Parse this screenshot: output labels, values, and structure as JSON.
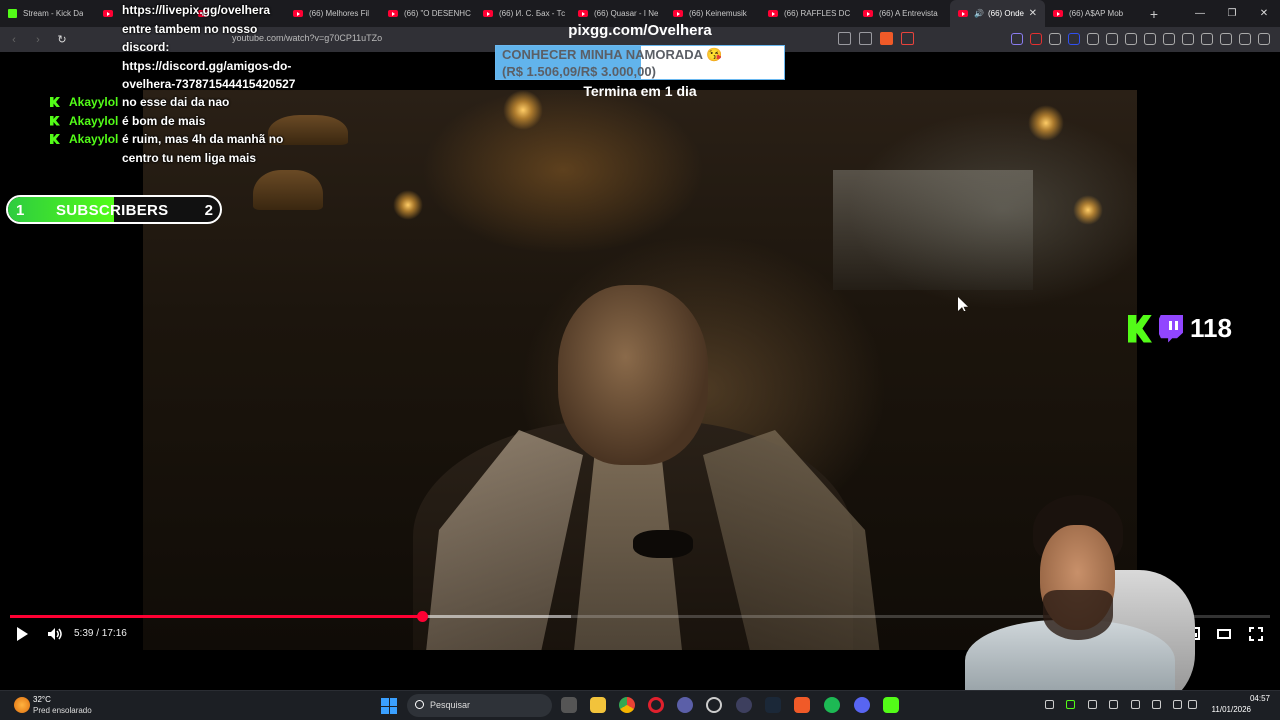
{
  "browser": {
    "tabs": [
      {
        "label": "Stream - Kick Da",
        "kind": "kick"
      },
      {
        "label": "",
        "kind": "youtube"
      },
      {
        "label": "",
        "kind": "youtube"
      },
      {
        "label": "(66) Melhores Fil",
        "kind": "youtube"
      },
      {
        "label": "(66) \"O DESENHC",
        "kind": "youtube"
      },
      {
        "label": "(66) И. С. Бах - Тс",
        "kind": "youtube"
      },
      {
        "label": "(66) Quasar - I Ne",
        "kind": "youtube"
      },
      {
        "label": "(66) Keinemusik",
        "kind": "youtube"
      },
      {
        "label": "(66) RAFFLES DC",
        "kind": "youtube"
      },
      {
        "label": "(66) A Entrevista",
        "kind": "youtube"
      },
      {
        "label": "(66) Onde",
        "kind": "youtube",
        "active": true,
        "close": "✕"
      },
      {
        "label": "(66) A$AP Mob",
        "kind": "youtube"
      }
    ],
    "new_tab": "+",
    "url": "youtube.com/watch?v=g70CP11uTZo"
  },
  "chat": {
    "first_message": "https://livepix.gg/ovelhera entre tambem no nosso discord: https://discord.gg/amigos-do-ovelhera-737871544415420527",
    "messages": [
      {
        "user": "Akayylol",
        "text": "no esse dai da nao"
      },
      {
        "user": "Akayylol",
        "text": "é bom de mais"
      },
      {
        "user": "Akayylol",
        "text": "é ruim, mas 4h da manhã no centro tu nem liga mais"
      }
    ]
  },
  "sub_goal": {
    "start": "1",
    "label": "SUBSCRIBERS",
    "end": "2",
    "progress": 0.5
  },
  "pix_goal": {
    "title": "pixgg.com/Ovelhera",
    "goal_name": "CONHECER MINHA NAMORADA 😘",
    "amount": "(R$ 1.506,09/R$ 3.000,00)",
    "progress": 0.502,
    "ends": "Termina em 1 dia"
  },
  "viewers": {
    "count": "118"
  },
  "player": {
    "time": "5:39 / 17:16",
    "played_fraction": 0.327,
    "buffered_fraction": 0.445
  },
  "taskbar": {
    "weather_temp": "32°C",
    "weather_desc": "Pred ensolarado",
    "search_placeholder": "Pesquisar",
    "time": "04:57",
    "date": "11/01/2026"
  },
  "colors": {
    "kick_green": "#53fc18",
    "twitch_purple": "#9146ff",
    "youtube_red": "#ff0033",
    "pix_blue": "#62b4ec"
  }
}
